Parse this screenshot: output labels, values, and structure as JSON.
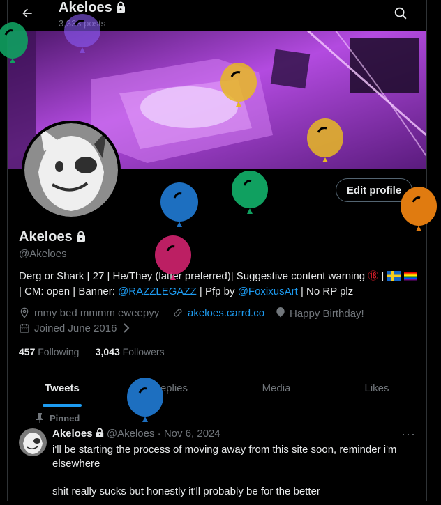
{
  "header": {
    "name": "Akeloes",
    "posts": "3,333 posts"
  },
  "profile": {
    "name": "Akeloes",
    "handle": "@Akeloes",
    "edit_label": "Edit profile",
    "bio_1": "Derg or Shark | 27 | He/They (latter preferred)| Suggestive content warning ",
    "bio_18": "⑱",
    "bio_2": " | CM: open | Banner: ",
    "bio_link1": "@RAZZLEGAZZ",
    "bio_3": " | Pfp by ",
    "bio_link2": "@FoxixusArt",
    "bio_4": " | No RP plz",
    "location": "mmy bed mmmm eweepyy",
    "website": "akeloes.carrd.co",
    "birthday": "Happy Birthday!",
    "joined": "Joined June 2016"
  },
  "stats": {
    "following_count": "457",
    "following_label": "Following",
    "followers_count": "3,043",
    "followers_label": "Followers"
  },
  "tabs": [
    "Tweets",
    "Replies",
    "Media",
    "Likes"
  ],
  "tweet": {
    "pinned": "Pinned",
    "name": "Akeloes",
    "handle": "@Akeloes",
    "date": "Nov 6, 2024",
    "text": "i'll be starting the process of moving away from this site soon, reminder i'm elsewhere\n\nshit really sucks but honestly it'll probably be for the better"
  },
  "colors": {
    "accent": "#1d9bf0",
    "balloon_purple": "#8b5cf6",
    "balloon_green": "#10a060",
    "balloon_yellow": "#e8b923",
    "balloon_blue": "#1d6fc0",
    "balloon_pink": "#d0226e",
    "balloon_orange": "#e07b10"
  },
  "icons": [
    "back-arrow-icon",
    "lock-icon",
    "search-icon",
    "location-icon",
    "link-icon",
    "balloon-icon",
    "calendar-icon",
    "chevron-right-icon",
    "pin-icon",
    "more-icon"
  ]
}
